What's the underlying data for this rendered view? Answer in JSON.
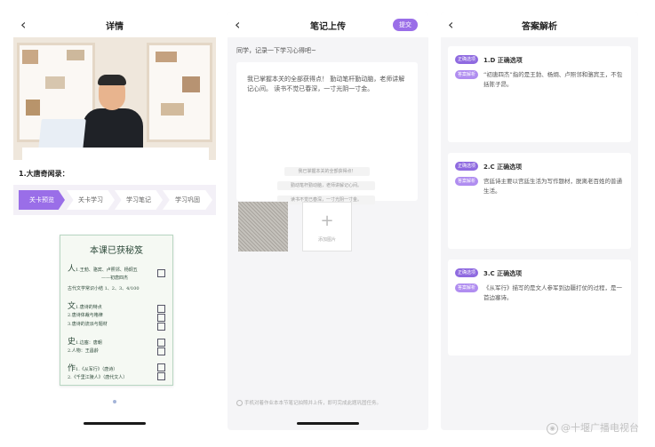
{
  "panel1": {
    "title": "详情",
    "back_icon": "chevron-left-icon",
    "section_label": "1.大唐奇闻录：",
    "steps": [
      "关卡预览",
      "关卡学习",
      "学习笔记",
      "学习巩固"
    ],
    "doc": {
      "title": "本课已获秘笈",
      "lines": [
        {
          "big": "人",
          "text": "1.王勃、骆宾、卢照邻、杨炯五"
        },
        {
          "big": "",
          "text": "——初唐四杰"
        },
        {
          "big": "",
          "text": "古代文学常识小结 1、2、3、4/100"
        },
        {
          "big": "文",
          "text": "1.唐诗的特点"
        },
        {
          "big": "",
          "text": "2.唐诗体裁与格律"
        },
        {
          "big": "",
          "text": "3.唐诗的流派与题材"
        },
        {
          "big": "史",
          "text": "1.边塞：唐朝"
        },
        {
          "big": "",
          "text": "2.人物：王昌龄"
        },
        {
          "big": "作",
          "text": "1.《从军行》（唐诗）"
        },
        {
          "big": "",
          "text": "2.《千里江陵人》（唐代文人）"
        }
      ]
    }
  },
  "panel2": {
    "title": "笔记上传",
    "submit_label": "提交",
    "prompt": "同学，记录一下学习心得吧~",
    "note_text": "我已掌握本关的全部获得点！ 勤动笔杆勤动脑，老师讲解记心间。 读书不觉已春深，一寸光阴一寸金。",
    "chips": [
      "我已掌握本关的全部获得点！",
      "勤动笔杆勤动脑，老师讲解记心间。",
      "读书不觉已春深，一寸光阴一寸金。"
    ],
    "add_label": "添加图片",
    "footnote": "手机对着作业本本节笔记拍照并上传，即可完成此题巩固任务。"
  },
  "panel3": {
    "title": "答案解析",
    "tag_correct": "正确选项",
    "tag_explain": "答案解析",
    "cards": [
      {
        "answer": "1.D 正确选项",
        "explain": "“初唐四杰”指的是王勃、杨炯、卢照邻和骆宾王，不包括陈子昂。"
      },
      {
        "answer": "2.C 正确选项",
        "explain": "宫廷诗主要以宫廷生活为写作题材，脱离老百姓的普通生活。"
      },
      {
        "answer": "3.C 正确选项",
        "explain": "《从军行》描写的是文人参军到边疆打仗的过程，是一首边塞诗。"
      }
    ]
  },
  "watermark": "@十堰广播电视台",
  "colors": {
    "accent": "#9a6ee8",
    "tag": "#8f6ae0"
  }
}
